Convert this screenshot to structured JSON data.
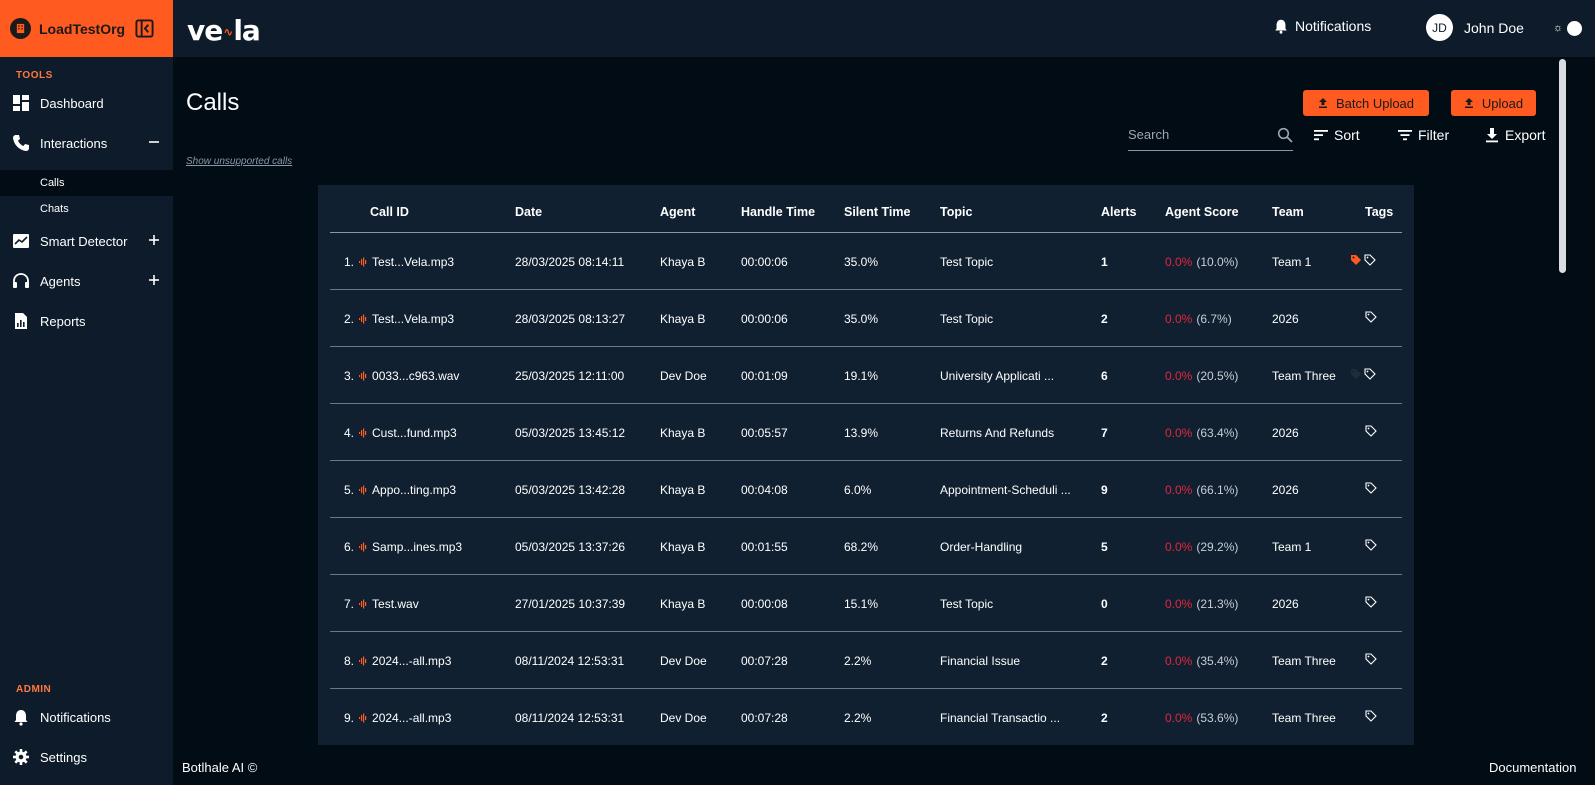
{
  "org": {
    "name": "LoadTestOrg"
  },
  "sidebar": {
    "tools_label": "TOOLS",
    "admin_label": "ADMIN",
    "items": [
      {
        "label": "Dashboard",
        "icon": "dashboard-icon"
      },
      {
        "label": "Interactions",
        "icon": "phone-icon",
        "toggle": "minus"
      },
      {
        "label": "Smart Detector",
        "icon": "chart-check-icon",
        "toggle": "plus"
      },
      {
        "label": "Agents",
        "icon": "headset-icon",
        "toggle": "plus"
      },
      {
        "label": "Reports",
        "icon": "report-icon"
      }
    ],
    "sub_items": [
      {
        "label": "Calls",
        "active": true
      },
      {
        "label": "Chats",
        "active": false
      }
    ],
    "admin_items": [
      {
        "label": "Notifications",
        "icon": "bell-icon"
      },
      {
        "label": "Settings",
        "icon": "gear-icon"
      }
    ]
  },
  "header": {
    "logo_left": "ve",
    "logo_right": "la",
    "notifications_label": "Notifications",
    "avatar_initials": "JD",
    "username": "John Doe"
  },
  "page": {
    "title": "Calls",
    "batch_upload_label": "Batch Upload",
    "upload_label": "Upload",
    "search_placeholder": "Search",
    "sort_label": "Sort",
    "filter_label": "Filter",
    "export_label": "Export",
    "show_unsupported": "Show unsupported calls"
  },
  "table": {
    "headers": [
      "Call ID",
      "Date",
      "Agent",
      "Handle Time",
      "Silent Time",
      "Topic",
      "Alerts",
      "Agent Score",
      "Team",
      "Tags"
    ],
    "rows": [
      {
        "num": "1.",
        "call_id": "Test...Vela.mp3",
        "date": "28/03/2025 08:14:11",
        "agent": "Khaya B",
        "handle": "00:00:06",
        "silent": "35.0%",
        "topic": "Test Topic",
        "alerts": "1",
        "score": "0.0%",
        "score_pct": "(10.0%)",
        "team": "Team 1",
        "tag_filled": true
      },
      {
        "num": "2.",
        "call_id": "Test...Vela.mp3",
        "date": "28/03/2025 08:13:27",
        "agent": "Khaya B",
        "handle": "00:00:06",
        "silent": "35.0%",
        "topic": "Test Topic",
        "alerts": "2",
        "score": "0.0%",
        "score_pct": "(6.7%)",
        "team": "2026",
        "tag_filled": false
      },
      {
        "num": "3.",
        "call_id": "0033...c963.wav",
        "date": "25/03/2025 12:11:00",
        "agent": "Dev Doe",
        "handle": "00:01:09",
        "silent": "19.1%",
        "topic": "University Applicati ...",
        "alerts": "6",
        "score": "0.0%",
        "score_pct": "(20.5%)",
        "team": "Team Three",
        "tag_filled": true
      },
      {
        "num": "4.",
        "call_id": "Cust...fund.mp3",
        "date": "05/03/2025 13:45:12",
        "agent": "Khaya B",
        "handle": "00:05:57",
        "silent": "13.9%",
        "topic": "Returns And Refunds",
        "alerts": "7",
        "score": "0.0%",
        "score_pct": "(63.4%)",
        "team": "2026",
        "tag_filled": false
      },
      {
        "num": "5.",
        "call_id": "Appo...ting.mp3",
        "date": "05/03/2025 13:42:28",
        "agent": "Khaya B",
        "handle": "00:04:08",
        "silent": "6.0%",
        "topic": "Appointment-Scheduli ...",
        "alerts": "9",
        "score": "0.0%",
        "score_pct": "(66.1%)",
        "team": "2026",
        "tag_filled": false
      },
      {
        "num": "6.",
        "call_id": "Samp...ines.mp3",
        "date": "05/03/2025 13:37:26",
        "agent": "Khaya B",
        "handle": "00:01:55",
        "silent": "68.2%",
        "topic": "Order-Handling",
        "alerts": "5",
        "score": "0.0%",
        "score_pct": "(29.2%)",
        "team": "Team 1",
        "tag_filled": false
      },
      {
        "num": "7.",
        "call_id": "Test.wav",
        "date": "27/01/2025 10:37:39",
        "agent": "Khaya B",
        "handle": "00:00:08",
        "silent": "15.1%",
        "topic": "Test Topic",
        "alerts": "0",
        "score": "0.0%",
        "score_pct": "(21.3%)",
        "team": "2026",
        "tag_filled": false
      },
      {
        "num": "8.",
        "call_id": "2024...-all.mp3",
        "date": "08/11/2024 12:53:31",
        "agent": "Dev Doe",
        "handle": "00:07:28",
        "silent": "2.2%",
        "topic": "Financial Issue",
        "alerts": "2",
        "score": "0.0%",
        "score_pct": "(35.4%)",
        "team": "Team Three",
        "tag_filled": false
      },
      {
        "num": "9.",
        "call_id": "2024...-all.mp3",
        "date": "08/11/2024 12:53:31",
        "agent": "Dev Doe",
        "handle": "00:07:28",
        "silent": "2.2%",
        "topic": "Financial Transactio ...",
        "alerts": "2",
        "score": "0.0%",
        "score_pct": "(53.6%)",
        "team": "Team Three",
        "tag_filled": false
      }
    ]
  },
  "footer": {
    "left": "Botlhale AI ©",
    "right": "Documentation"
  },
  "colors": {
    "accent": "#ff5a1f",
    "background": "#020c14",
    "panel": "#0d1b2a",
    "table": "#112030",
    "score_red": "#e0283a"
  }
}
